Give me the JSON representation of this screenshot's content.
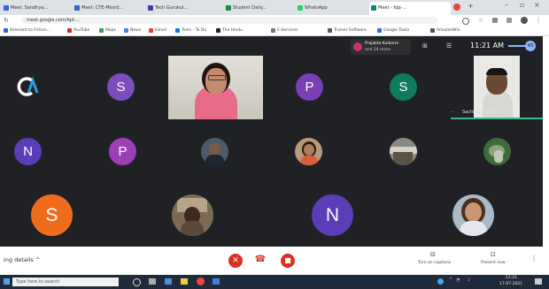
{
  "tabs": [
    {
      "label": "Meet, Sandhya..."
    },
    {
      "label": "Meet: CTE-Mksrd..."
    },
    {
      "label": "Tech Gurukul..."
    },
    {
      "label": "Student Daily..."
    },
    {
      "label": "WhatsApp"
    },
    {
      "label": "Meet - fqq-..."
    }
  ],
  "address": {
    "url": "meet.google.com/fqd-..."
  },
  "bookmarks": [
    "Relevant to Fiction...",
    "YouTube",
    "Maps",
    "News",
    "Gmail",
    "Tests - To Do",
    "The Hindu",
    "E-Services",
    "Trainer Software",
    "Google Tasks",
    "AmazonWin"
  ],
  "meet_top": {
    "presenter_label": "Prajakta Kulkarni",
    "presenter_sub": "and 24 more",
    "time": "11:21 AM",
    "count": "45"
  },
  "participants": {
    "cta_label": "CA",
    "s1": "S",
    "p1": "P",
    "s2": "S",
    "n1": "N",
    "p2": "P",
    "s3": "S",
    "n2": "N",
    "speaker_name": "Sachin Gaikwad"
  },
  "bottom": {
    "meeting_details": "ing details",
    "people_label": "Turn on captions",
    "present_label": "Present now"
  },
  "taskbar": {
    "search": "Type here to search",
    "time": "11:21",
    "date": "17-07-2021"
  },
  "colors": {
    "meet_bg": "#202124",
    "s_purple": "#7c4dbf",
    "p_purple": "#7b3fb5",
    "s_teal": "#0f7a5e",
    "n_blue": "#5c3db8",
    "s_orange": "#ef6c1c",
    "end_red": "#d93025"
  }
}
